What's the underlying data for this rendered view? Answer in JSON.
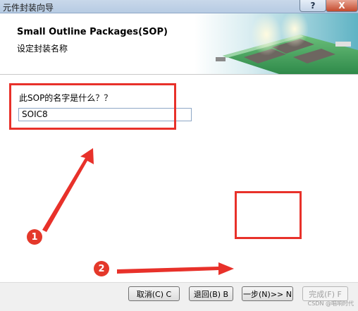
{
  "window": {
    "title": "元件封装向导",
    "help_glyph": "?",
    "close_glyph": "X"
  },
  "header": {
    "title": "Small Outline Packages(SOP)",
    "subtitle": "设定封装名称"
  },
  "form": {
    "question": "此SOP的名字是什么？？",
    "name_value": "SOIC8"
  },
  "annotations": {
    "badge_1": "1",
    "badge_2": "2",
    "accent_color": "#e8312a"
  },
  "buttons": {
    "cancel": "取消(C) C",
    "back": "退回(B) B",
    "next": "一步(N)>> N",
    "finish": "完成(F) F"
  },
  "watermark": "CSDN @唱响时代"
}
